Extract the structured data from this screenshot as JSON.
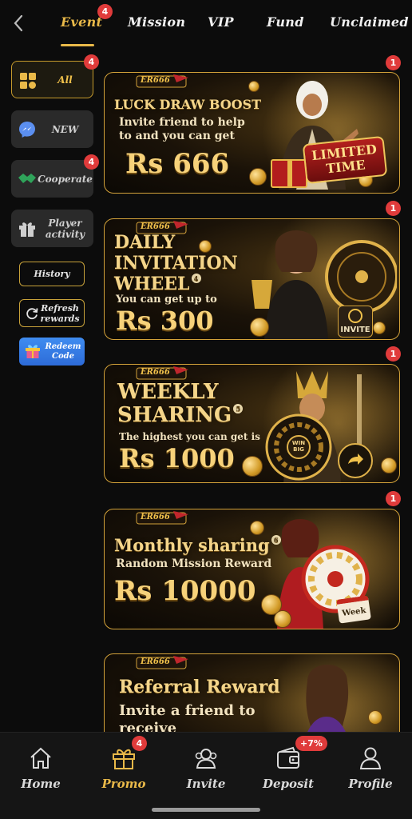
{
  "topnav": {
    "tabs": [
      {
        "label": "Event",
        "badge": "4"
      },
      {
        "label": "Mission"
      },
      {
        "label": "VIP"
      },
      {
        "label": "Fund"
      },
      {
        "label": "Unclaimed"
      }
    ],
    "active_tab": "Event",
    "back_icon": "chevron-left-icon"
  },
  "sidebar": {
    "categories": [
      {
        "label": "All",
        "badge": "4",
        "icon": "grid-icon",
        "active": true
      },
      {
        "label": "NEW",
        "icon": "messenger-icon"
      },
      {
        "label": "Cooperate",
        "badge": "4",
        "icon": "handshake-icon"
      },
      {
        "label": "Player activity",
        "icon": "gift-icon"
      }
    ],
    "history_label": "History",
    "refresh_label": "Refresh rewards",
    "redeem_label": "Redeem Code"
  },
  "banners": [
    {
      "logo": "ER666",
      "title": "LUCK DRAW BOOST",
      "subtitle": "Invite friend to help to and you can get",
      "amount": "Rs 666",
      "tag": "LIMITED TIME",
      "badge": "1"
    },
    {
      "logo": "ER666",
      "title": "DAILY INVITATION WHEEL",
      "title_sup": "4",
      "subtitle": "You can get up to",
      "amount": "Rs 300",
      "tag": "INVITE",
      "badge": "1"
    },
    {
      "logo": "ER666",
      "title": "WEEKLY SHARING",
      "title_sup": "5",
      "subtitle": "The highest you can get is",
      "amount": "Rs 1000",
      "tag": "WIN BIG",
      "badge": "1"
    },
    {
      "logo": "ER666",
      "title": "Monthly sharing",
      "title_sup": "6",
      "subtitle": "Random Mission Reward",
      "amount": "Rs 10000",
      "tag": "Week",
      "badge": "1"
    },
    {
      "logo": "ER666",
      "title": "Referral Reward",
      "subtitle": "Invite a friend to receive"
    }
  ],
  "bottomnav": {
    "items": [
      {
        "label": "Home",
        "icon": "home-icon"
      },
      {
        "label": "Promo",
        "icon": "gift-icon",
        "badge": "4",
        "active": true
      },
      {
        "label": "Invite",
        "icon": "users-icon"
      },
      {
        "label": "Deposit",
        "icon": "wallet-icon",
        "badge": "+7%"
      },
      {
        "label": "Profile",
        "icon": "profile-icon"
      }
    ]
  },
  "colors": {
    "accent": "#e9b949",
    "badge": "#e03b3b",
    "background": "#0c0c0c"
  }
}
